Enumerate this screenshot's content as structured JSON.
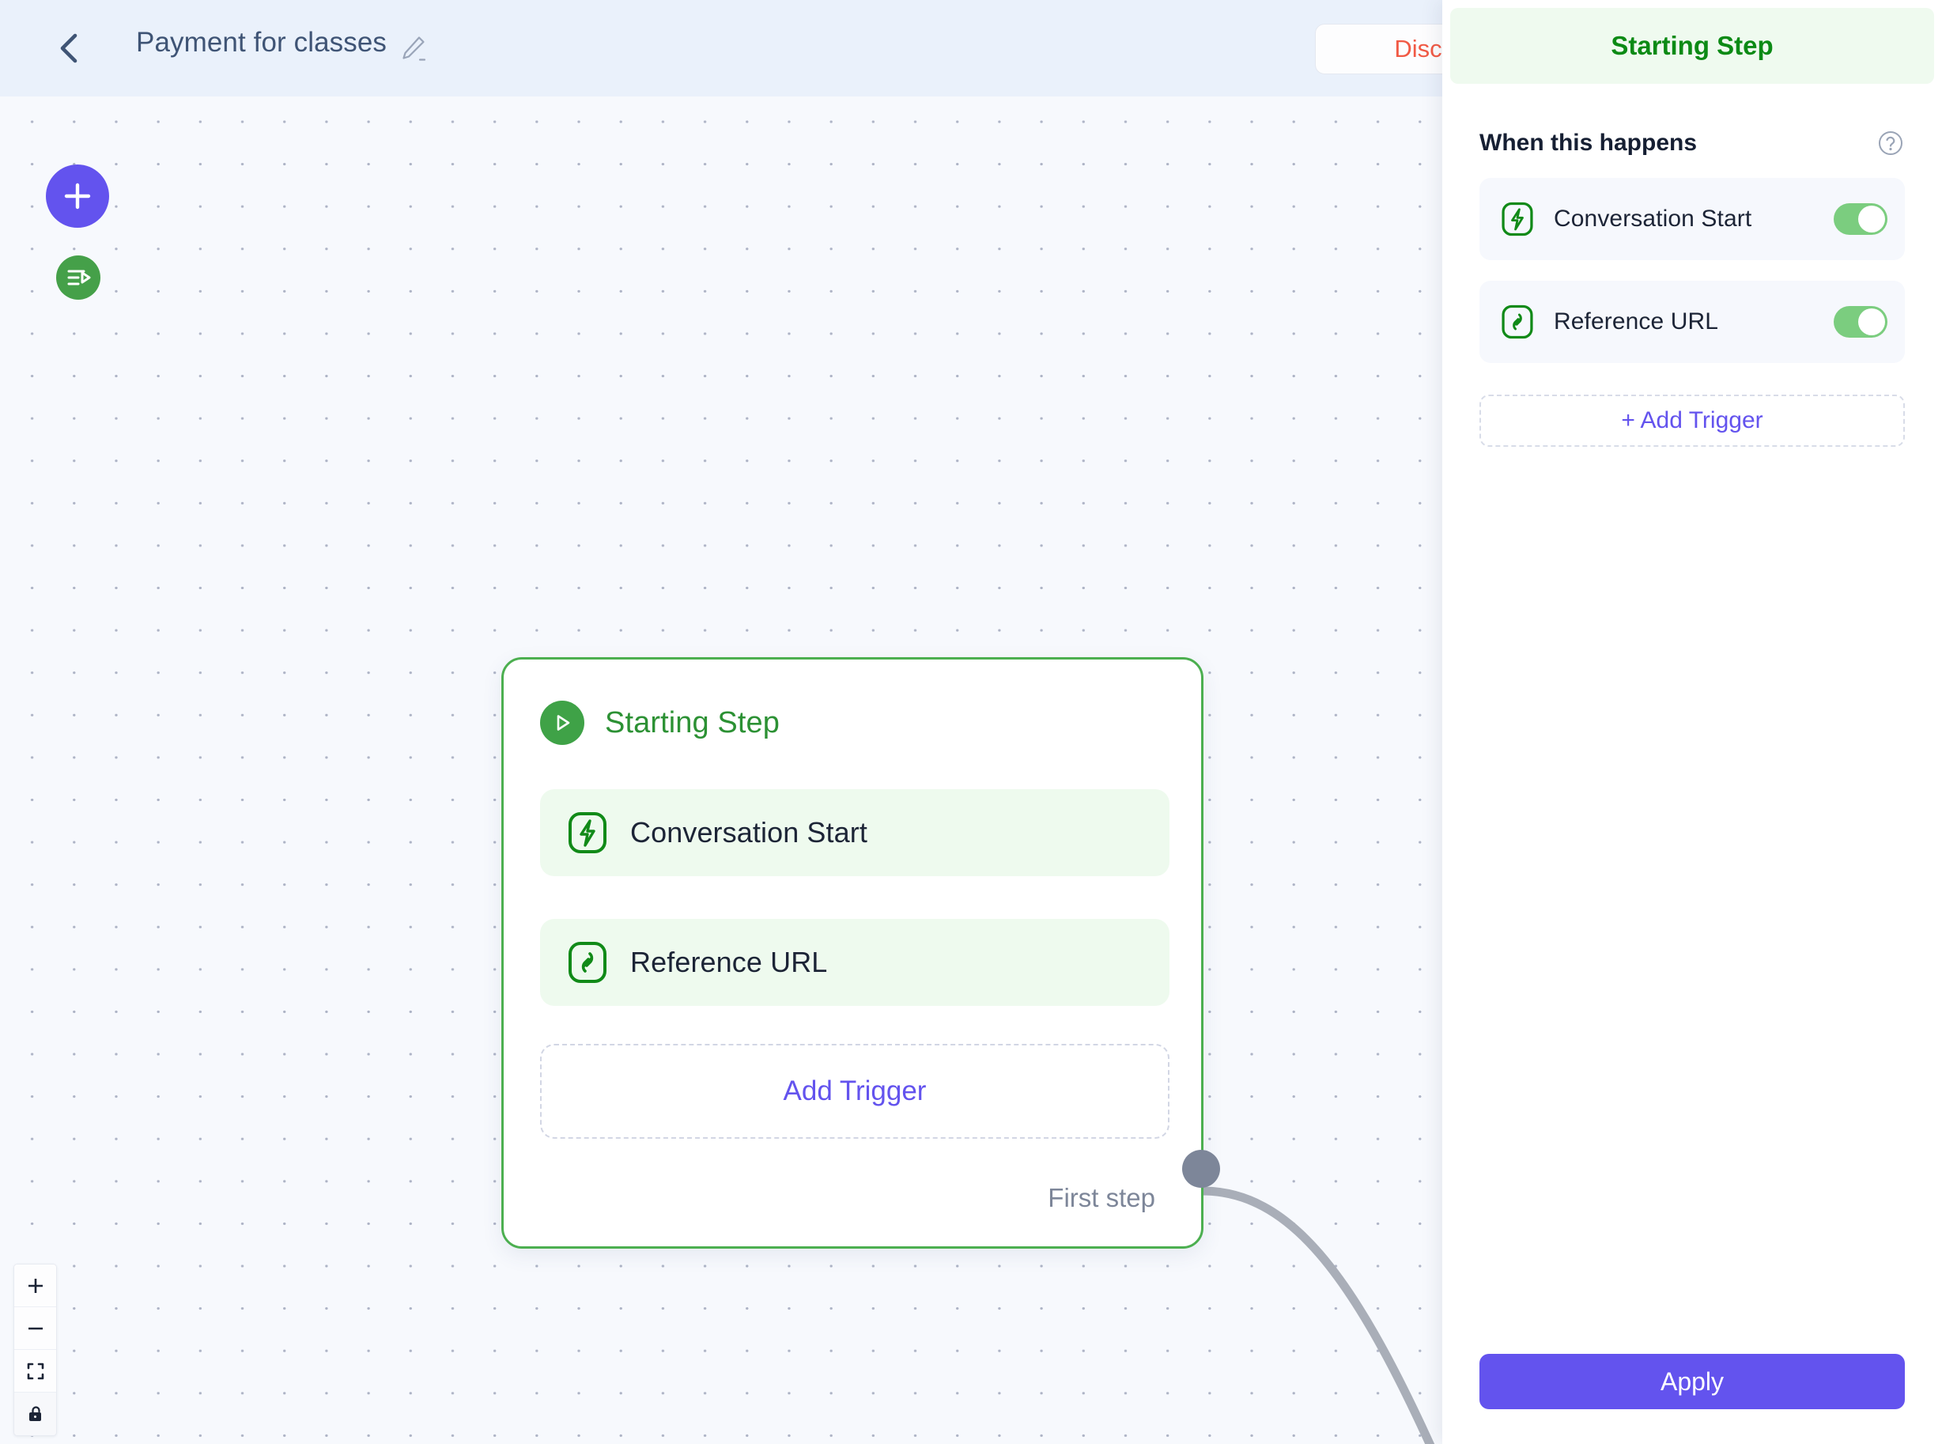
{
  "header": {
    "back_icon": "chevron-left-icon",
    "title": "Payment for classes",
    "edit_icon": "pencil-icon",
    "discard_label": "Discard c"
  },
  "canvas": {
    "add_node_icon": "plus-icon",
    "test_flow_icon": "run-flow-icon",
    "zoom_controls": [
      {
        "name": "zoom-in",
        "icon": "plus-icon"
      },
      {
        "name": "zoom-out",
        "icon": "minus-icon"
      },
      {
        "name": "fit-view",
        "icon": "fit-screen-icon"
      },
      {
        "name": "lock-toggle",
        "icon": "unlock-icon"
      }
    ]
  },
  "node": {
    "title": "Starting Step",
    "title_icon": "play-circle-icon",
    "triggers": [
      {
        "label": "Conversation Start",
        "icon": "lightning-bolt-icon"
      },
      {
        "label": "Reference URL",
        "icon": "link-icon"
      }
    ],
    "add_trigger_label": "Add Trigger",
    "first_step_label": "First step",
    "handle_name": "source-handle"
  },
  "panel": {
    "title": "Starting Step",
    "section_title": "When this happens",
    "help_icon": "question-mark-icon",
    "triggers": [
      {
        "label": "Conversation Start",
        "icon": "lightning-bolt-icon",
        "enabled": true
      },
      {
        "label": "Reference URL",
        "icon": "link-icon",
        "enabled": true
      }
    ],
    "add_trigger_label": "+ Add Trigger",
    "apply_label": "Apply"
  },
  "colors": {
    "accent_purple": "#6353ee",
    "green": "#4caf50",
    "green_dark": "#2c9134",
    "danger_red": "#f15a45",
    "canvas_bg": "#f7f9fd",
    "header_bg": "#eaf1fb"
  }
}
